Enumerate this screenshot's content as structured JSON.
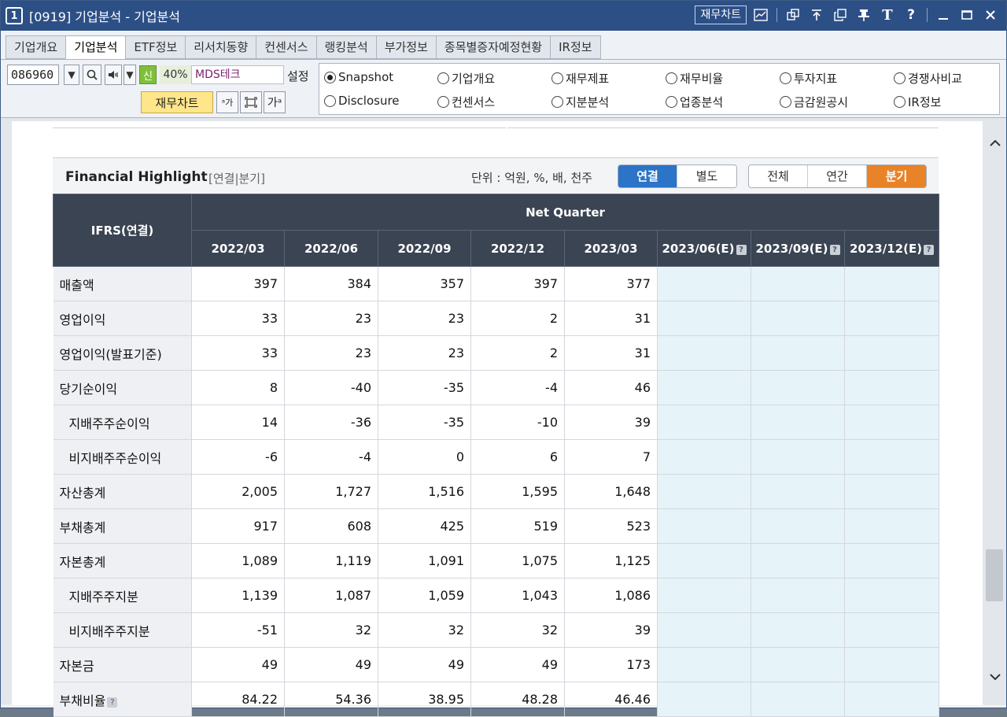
{
  "window": {
    "number": "1",
    "title": "[0919] 기업분석 - 기업분석",
    "finance_chart_label": "재무차트"
  },
  "tabs": [
    "기업개요",
    "기업분석",
    "ETF정보",
    "리서치동향",
    "컨센서스",
    "랭킹분석",
    "부가정보",
    "종목별증자예정현황",
    "IR정보"
  ],
  "active_tab": "기업분석",
  "controls": {
    "stock_code": "086960",
    "badge": "신",
    "margin_pct": "40%",
    "company_name": "MDS테크",
    "setting_label": "설정",
    "finance_chart_button": "재무차트"
  },
  "report_options": [
    {
      "label": "Snapshot",
      "selected": true
    },
    {
      "label": "기업개요",
      "selected": false
    },
    {
      "label": "재무제표",
      "selected": false
    },
    {
      "label": "재무비율",
      "selected": false
    },
    {
      "label": "투자지표",
      "selected": false
    },
    {
      "label": "경쟁사비교",
      "selected": false
    },
    {
      "label": "Disclosure",
      "selected": false
    },
    {
      "label": "컨센서스",
      "selected": false
    },
    {
      "label": "지분분석",
      "selected": false
    },
    {
      "label": "업종분석",
      "selected": false
    },
    {
      "label": "금감원공시",
      "selected": false
    },
    {
      "label": "IR정보",
      "selected": false
    }
  ],
  "highlight": {
    "title": "Financial Highlight",
    "subtitle": "[연결|분기]",
    "unit": "단위 : 억원, %, 배, 천주",
    "basis_options": [
      "연결",
      "별도"
    ],
    "basis_selected": "연결",
    "period_options": [
      "전체",
      "연간",
      "분기"
    ],
    "period_selected": "분기",
    "table": {
      "corner_header": "IFRS(연결)",
      "group_header": "Net Quarter",
      "periods": [
        "2022/03",
        "2022/06",
        "2022/09",
        "2022/12",
        "2023/03",
        "2023/06(E)",
        "2023/09(E)",
        "2023/12(E)"
      ],
      "rows": [
        {
          "label": "매출액",
          "indent": false,
          "values": [
            "397",
            "384",
            "357",
            "397",
            "377"
          ]
        },
        {
          "label": "영업이익",
          "indent": false,
          "values": [
            "33",
            "23",
            "23",
            "2",
            "31"
          ]
        },
        {
          "label": "영업이익(발표기준)",
          "indent": false,
          "values": [
            "33",
            "23",
            "23",
            "2",
            "31"
          ]
        },
        {
          "label": "당기순이익",
          "indent": false,
          "values": [
            "8",
            "-40",
            "-35",
            "-4",
            "46"
          ]
        },
        {
          "label": "지배주주순이익",
          "indent": true,
          "values": [
            "14",
            "-36",
            "-35",
            "-10",
            "39"
          ]
        },
        {
          "label": "비지배주주순이익",
          "indent": true,
          "values": [
            "-6",
            "-4",
            "0",
            "6",
            "7"
          ]
        },
        {
          "label": "자산총계",
          "indent": false,
          "values": [
            "2,005",
            "1,727",
            "1,516",
            "1,595",
            "1,648"
          ]
        },
        {
          "label": "부채총계",
          "indent": false,
          "values": [
            "917",
            "608",
            "425",
            "519",
            "523"
          ]
        },
        {
          "label": "자본총계",
          "indent": false,
          "values": [
            "1,089",
            "1,119",
            "1,091",
            "1,075",
            "1,125"
          ]
        },
        {
          "label": "지배주주지분",
          "indent": true,
          "values": [
            "1,139",
            "1,087",
            "1,059",
            "1,043",
            "1,086"
          ]
        },
        {
          "label": "비지배주주지분",
          "indent": true,
          "values": [
            "-51",
            "32",
            "32",
            "32",
            "39"
          ]
        },
        {
          "label": "자본금",
          "indent": false,
          "values": [
            "49",
            "49",
            "49",
            "49",
            "173"
          ]
        },
        {
          "label": "부채비율",
          "indent": false,
          "values": [
            "84.22",
            "54.36",
            "38.95",
            "48.28",
            "46.46"
          ]
        }
      ]
    }
  },
  "colors": {
    "titlebar": "#2c4f86",
    "header": "#3a4452",
    "negative": "#e0190c",
    "estimate_bg": "#e6f3f9",
    "connected_active": "#2b74c8",
    "quarter_active": "#e98328"
  }
}
